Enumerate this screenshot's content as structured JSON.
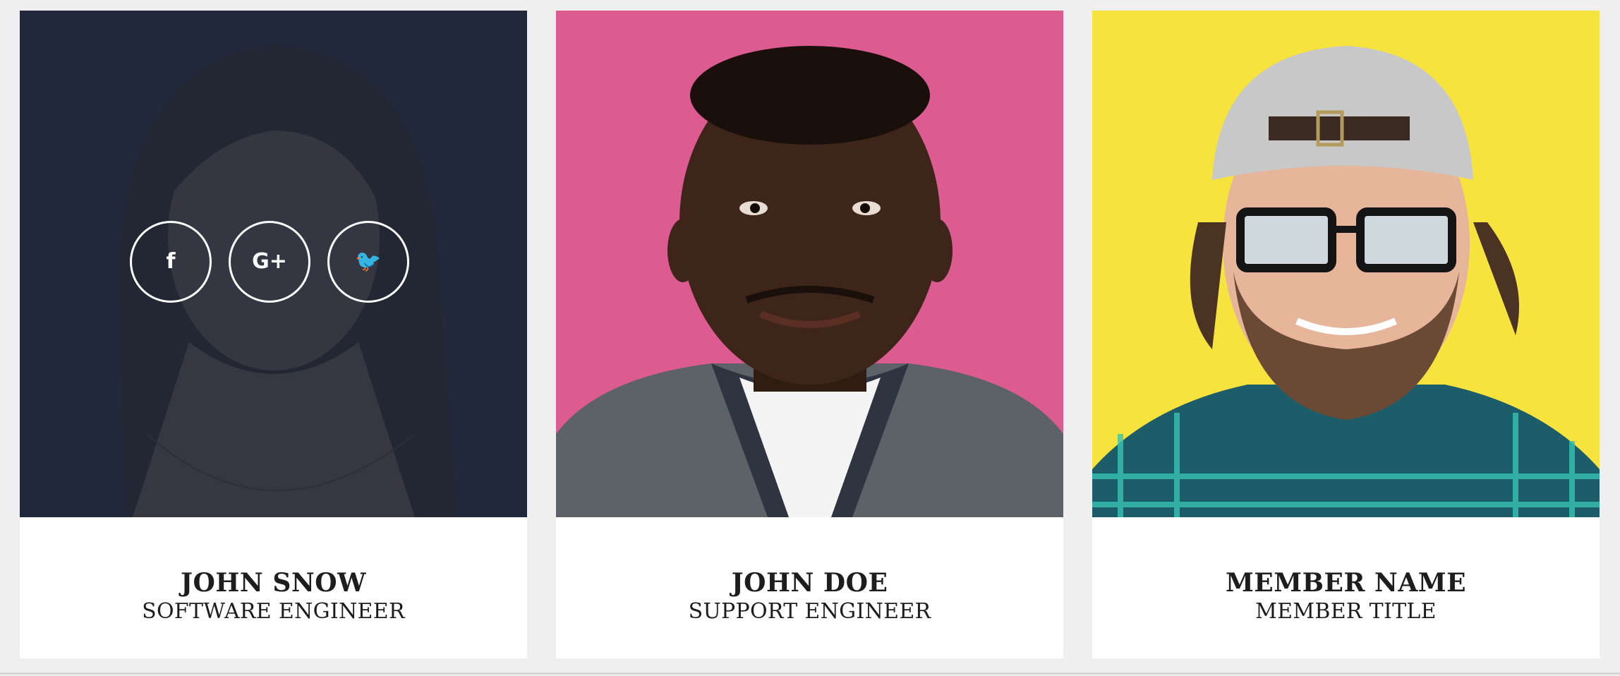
{
  "colors": {
    "page_background": "#efefef",
    "card_background": "#ffffff",
    "overlay": "#1e2638",
    "card1_backdrop": "#2a2f3f",
    "card2_backdrop": "#dc5c92",
    "card3_backdrop": "#f7e33e",
    "text": "#1d1d1d"
  },
  "team": {
    "members": [
      {
        "name": "JOHN SNOW",
        "title": "SOFTWARE ENGINEER",
        "photo_icon": "woman-portrait-photo",
        "hover_overlay": true,
        "socials": [
          {
            "icon": "facebook-icon",
            "glyph": "f"
          },
          {
            "icon": "google-plus-icon",
            "glyph": "G+"
          },
          {
            "icon": "twitter-icon",
            "glyph": "🐦"
          }
        ]
      },
      {
        "name": "JOHN DOE",
        "title": "SUPPORT ENGINEER",
        "photo_icon": "man-portrait-photo"
      },
      {
        "name": "MEMBER NAME",
        "title": "MEMBER TITLE",
        "photo_icon": "bearded-man-portrait-photo"
      }
    ]
  }
}
